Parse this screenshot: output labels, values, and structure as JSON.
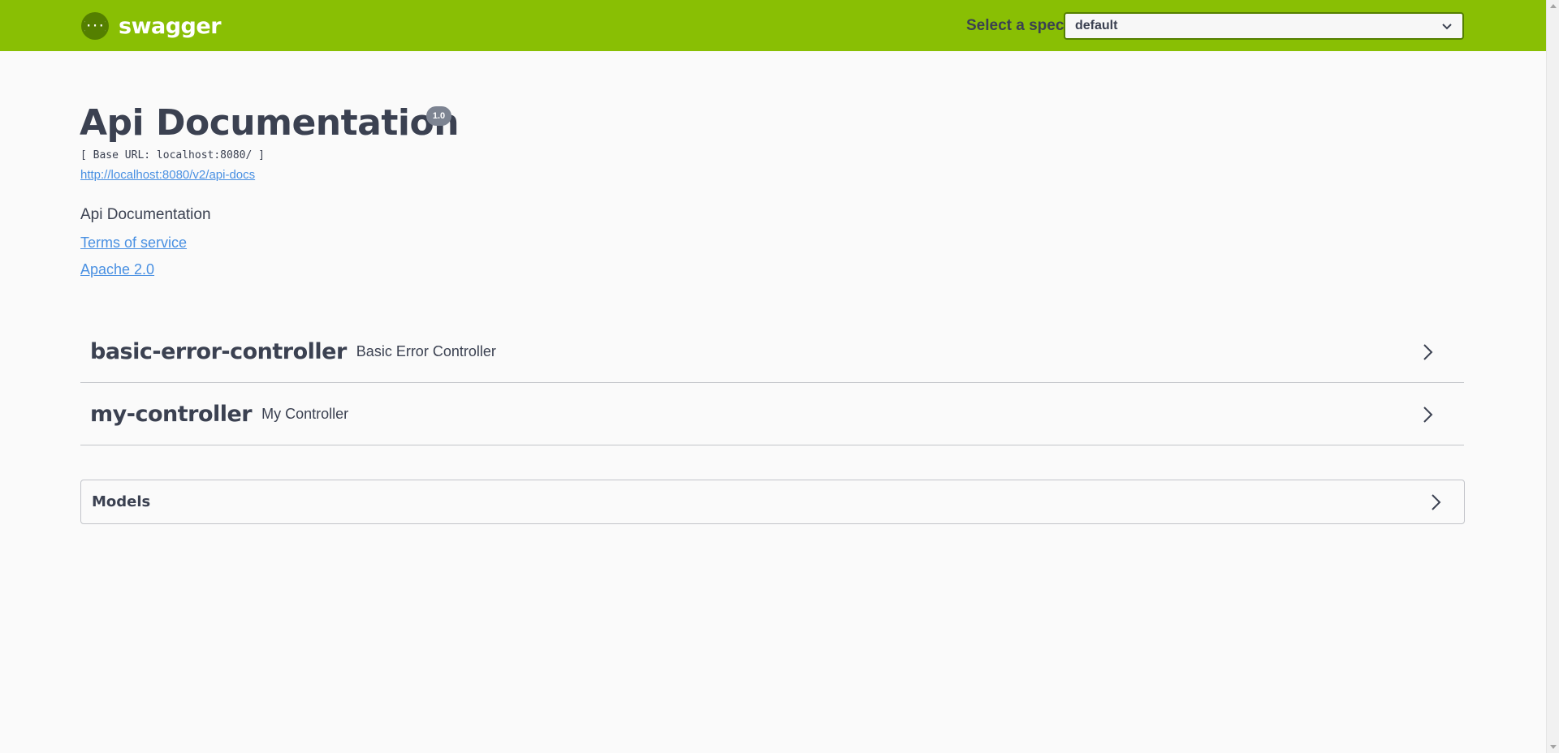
{
  "header": {
    "logo_text": "swagger",
    "spec_label": "Select a spec",
    "spec_selected": "default",
    "brand_color": "#89bf04"
  },
  "info": {
    "title": "Api Documentation",
    "version": "1.0",
    "base_url": "[ Base URL: localhost:8080/ ]",
    "api_docs_link": "http://localhost:8080/v2/api-docs",
    "description": "Api Documentation",
    "terms_of_service": "Terms of service",
    "license": "Apache 2.0"
  },
  "tags": [
    {
      "name": "basic-error-controller",
      "description": "Basic Error Controller",
      "icon": "chevron-right-icon"
    },
    {
      "name": "my-controller",
      "description": "My Controller",
      "icon": "chevron-right-icon"
    }
  ],
  "models": {
    "title": "Models",
    "icon": "chevron-right-icon"
  }
}
